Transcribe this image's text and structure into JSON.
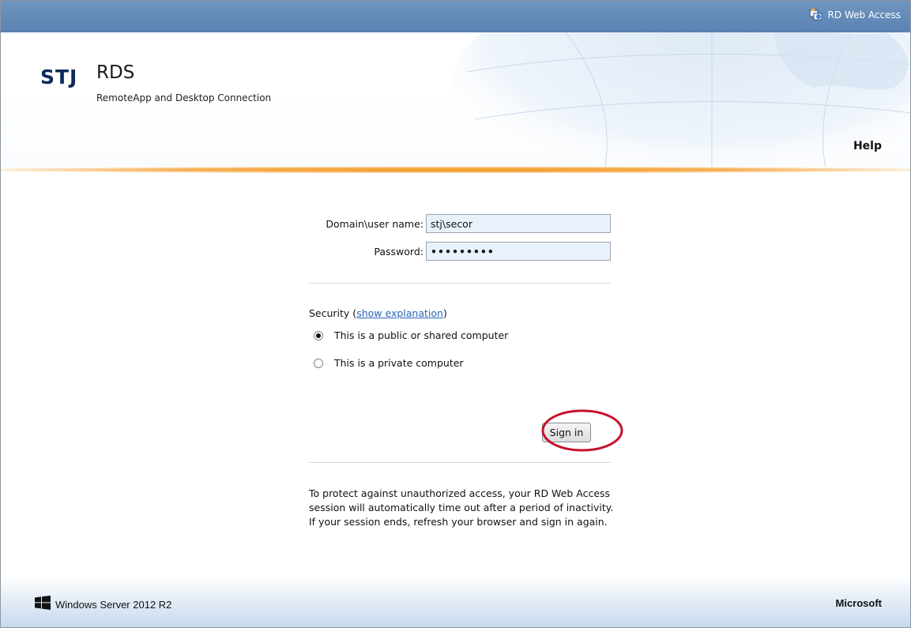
{
  "topbar": {
    "title": "RD Web Access",
    "icon": "rd-web-access-icon"
  },
  "header": {
    "logo": "STJ",
    "title": "RDS",
    "subtitle": "RemoteApp and Desktop Connection",
    "help_label": "Help"
  },
  "form": {
    "username_label": "Domain\\user name:",
    "username_value": "stj\\secor",
    "password_label": "Password:",
    "password_value": "•••••••••",
    "security_label": "Security (",
    "security_link": "show explanation",
    "security_close": ")",
    "radio_public": "This is a public or shared computer",
    "radio_private": "This is a private computer",
    "selected_option": "public",
    "signin_label": "Sign in",
    "note": "To protect against unauthorized access, your RD Web Access session will automatically time out after a period of inactivity. If your session ends, refresh your browser and sign in again."
  },
  "footer": {
    "windows_label": "Windows Server 2012 R2",
    "microsoft_label": "Microsoft"
  },
  "colors": {
    "topbar": "#5f87b5",
    "accent_orange": "#f19a1f",
    "highlight_circle": "#c8102e",
    "link": "#2a66b8"
  }
}
